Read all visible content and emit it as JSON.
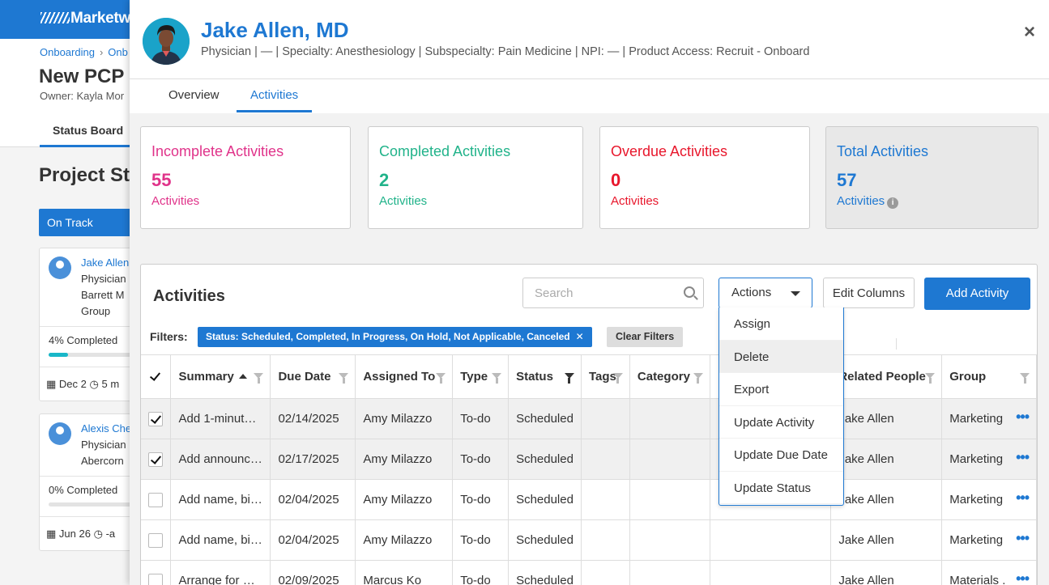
{
  "background": {
    "logo_text": "Marketw",
    "breadcrumb": [
      "Onboarding",
      "Onb"
    ],
    "page_title": "New PCP I",
    "owner": "Owner: Kayla Mor",
    "tab": "Status Board",
    "section_title": "Project Sta",
    "status_button": "On Track",
    "cards": [
      {
        "name": "Jake Allen",
        "lines": [
          "Physician",
          "Barrett M",
          "Group"
        ],
        "progress_label": "4% Completed",
        "progress": 0.04,
        "date": "Dec 2",
        "time": "5 m"
      },
      {
        "name": "Alexis Che",
        "lines": [
          "Physician",
          "Abercorn"
        ],
        "progress_label": "0% Completed",
        "progress": 0.0,
        "date": "Jun 26",
        "time": "-a"
      }
    ]
  },
  "drawer": {
    "name": "Jake Allen, MD",
    "subtitle": "Physician | — | Specialty: Anesthesiology | Subspecialty: Pain Medicine | NPI: — | Product Access: Recruit - Onboard",
    "close_label": "×",
    "tabs": [
      "Overview",
      "Activities"
    ],
    "active_tab": "Activities",
    "stats": [
      {
        "title": "Incomplete Activities",
        "value": "55",
        "unit": "Activities",
        "color": "#e0338a"
      },
      {
        "title": "Completed Activities",
        "value": "2",
        "unit": "Activities",
        "color": "#21b38a"
      },
      {
        "title": "Overdue Activities",
        "value": "0",
        "unit": "Activities",
        "color": "#e8172c"
      },
      {
        "title": "Total Activities",
        "value": "57",
        "unit": "Activities",
        "color": "#1e78d2"
      }
    ],
    "activities": {
      "title": "Activities",
      "search_placeholder": "Search",
      "actions_label": "Actions",
      "edit_columns_label": "Edit Columns",
      "add_activity_label": "Add Activity",
      "filters_label": "Filters:",
      "filter_chip": "Status: Scheduled, Completed, In Progress, On Hold, Not Applicable, Canceled",
      "clear_filters": "Clear Filters",
      "columns": [
        "Summary",
        "Due Date",
        "Assigned To",
        "Type",
        "Status",
        "Tags",
        "Category",
        "",
        "Related People",
        "Group"
      ],
      "rows": [
        {
          "checked": true,
          "summary": "Add 1-minut…",
          "due": "02/14/2025",
          "assigned": "Amy Milazzo",
          "type": "To-do",
          "status": "Scheduled",
          "tags": "",
          "category": "",
          "related": "Jake Allen",
          "group": "Marketing"
        },
        {
          "checked": true,
          "summary": "Add announc…",
          "due": "02/17/2025",
          "assigned": "Amy Milazzo",
          "type": "To-do",
          "status": "Scheduled",
          "tags": "",
          "category": "",
          "related": "Jake Allen",
          "group": "Marketing"
        },
        {
          "checked": false,
          "summary": "Add name, bi…",
          "due": "02/04/2025",
          "assigned": "Amy Milazzo",
          "type": "To-do",
          "status": "Scheduled",
          "tags": "",
          "category": "",
          "related": "Jake Allen",
          "group": "Marketing"
        },
        {
          "checked": false,
          "summary": "Add name, bi…",
          "due": "02/04/2025",
          "assigned": "Amy Milazzo",
          "type": "To-do",
          "status": "Scheduled",
          "tags": "",
          "category": "",
          "related": "Jake Allen",
          "group": "Marketing"
        },
        {
          "checked": false,
          "summary": "Arrange for …",
          "due": "02/09/2025",
          "assigned": "Marcus Ko",
          "type": "To-do",
          "status": "Scheduled",
          "tags": "",
          "category": "",
          "related": "Jake Allen",
          "group": "Materials ."
        }
      ]
    },
    "actions_menu": [
      "Assign",
      "Delete",
      "Export",
      "Update Activity",
      "Update Due Date",
      "Update Status"
    ],
    "actions_menu_hovered": "Delete"
  }
}
